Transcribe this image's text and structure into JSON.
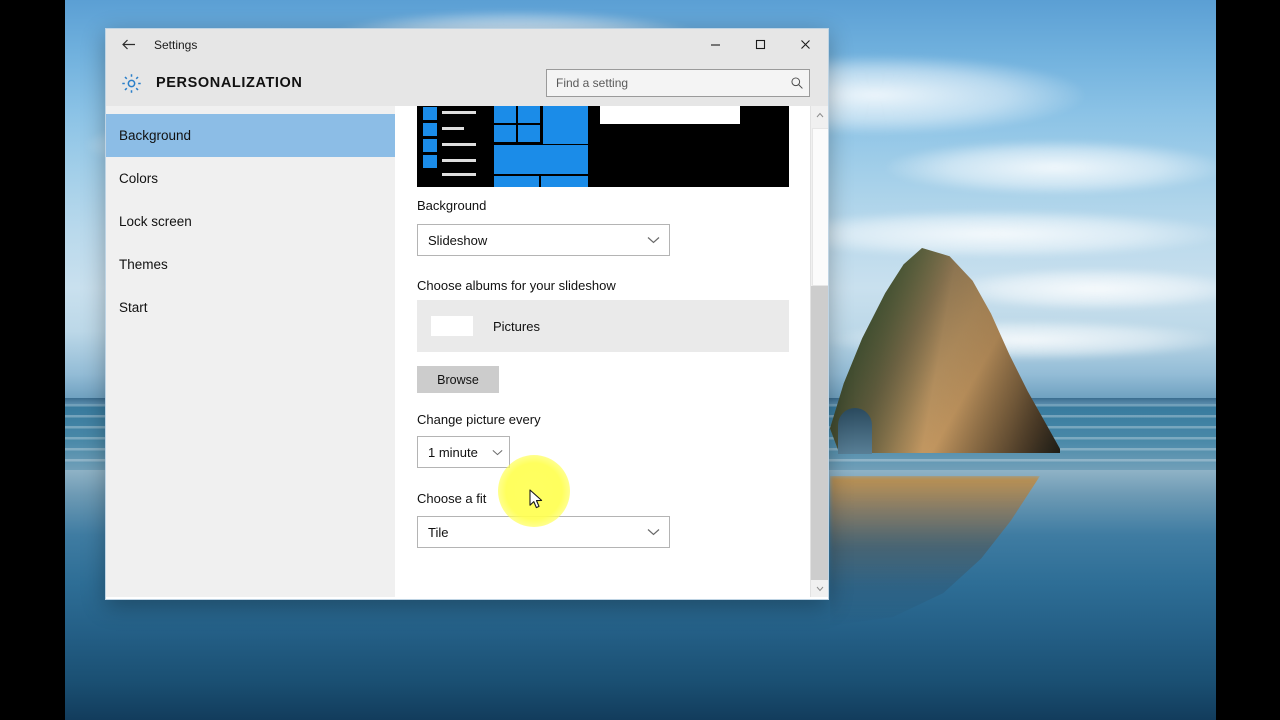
{
  "window": {
    "title": "Settings",
    "back_icon": "back-arrow-icon",
    "minimize_label": "—",
    "maximize_label": "☐",
    "close_label": "✕"
  },
  "header": {
    "icon": "gear-icon",
    "title": "PERSONALIZATION"
  },
  "search": {
    "placeholder": "Find a setting",
    "value": "",
    "icon": "search-icon"
  },
  "sidebar": {
    "items": [
      {
        "label": "Background",
        "selected": true
      },
      {
        "label": "Colors",
        "selected": false
      },
      {
        "label": "Lock screen",
        "selected": false
      },
      {
        "label": "Themes",
        "selected": false
      },
      {
        "label": "Start",
        "selected": false
      }
    ]
  },
  "main": {
    "preview_name": "start-menu-preview",
    "background_label": "Background",
    "background_value": "Slideshow",
    "albums_label": "Choose albums for your slideshow",
    "album_name": "Pictures",
    "browse_label": "Browse",
    "interval_label": "Change picture every",
    "interval_value": "1 minute",
    "fit_label": "Choose a fit",
    "fit_value": "Tile",
    "chevron_icon": "chevron-down-icon"
  },
  "scrollbar": {
    "up_icon": "scroll-up-arrow-icon",
    "down_icon": "scroll-down-arrow-icon"
  },
  "colors": {
    "accent": "#8cbde6",
    "tile_blue": "#1b8ce8",
    "highlight_yellow": "#ffff50",
    "sidebar_bg": "#f0f0f0",
    "titlebar_bg": "#e6e6e6"
  }
}
